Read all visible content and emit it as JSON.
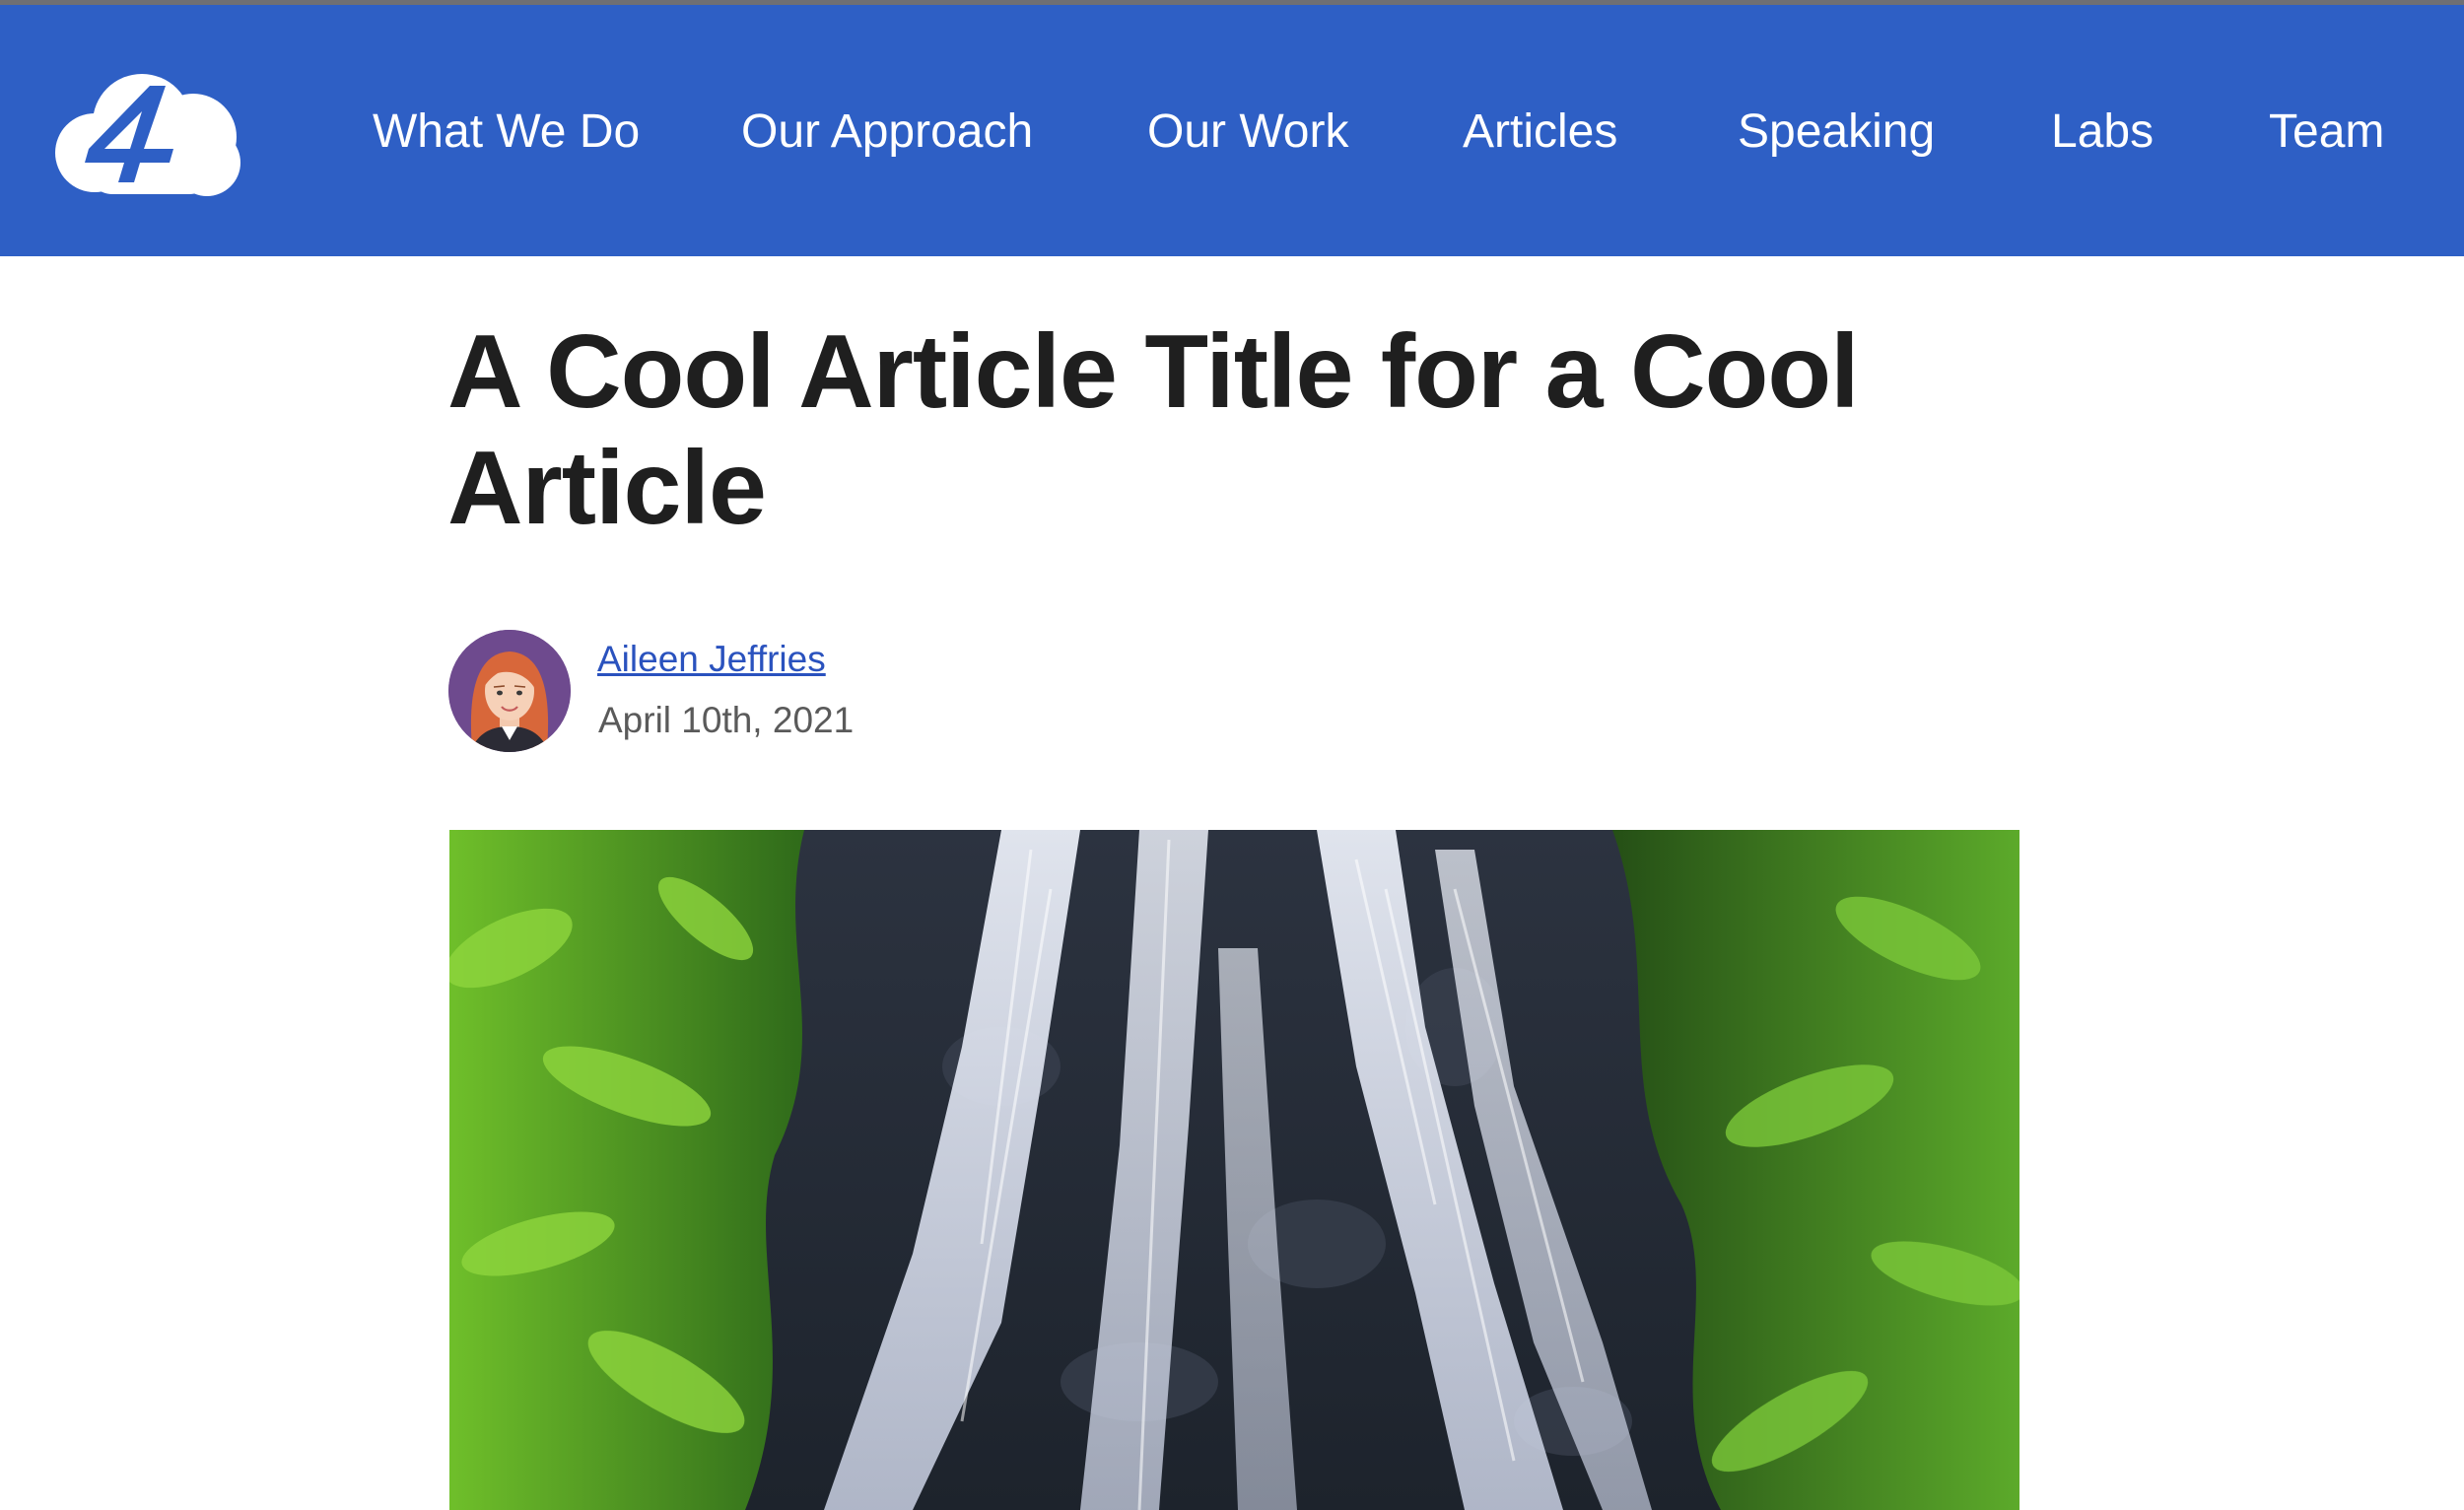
{
  "header": {
    "logo_icon": "four-cloud-logo-icon",
    "background_color": "#2e5fc5",
    "nav": [
      {
        "label": "What We Do"
      },
      {
        "label": "Our Approach"
      },
      {
        "label": "Our Work"
      },
      {
        "label": "Articles"
      },
      {
        "label": "Speaking"
      },
      {
        "label": "Labs"
      },
      {
        "label": "Team"
      }
    ]
  },
  "article": {
    "title": "A Cool Article Title for a Cool Article",
    "author": {
      "name": "Aileen Jeffries",
      "avatar_icon": "author-avatar-icon"
    },
    "date": "April 10th, 2021",
    "hero_image_icon": "waterfall-image-icon"
  },
  "colors": {
    "title": "#1f1f1f",
    "link": "#2a52be",
    "date": "#5a5a5a"
  }
}
